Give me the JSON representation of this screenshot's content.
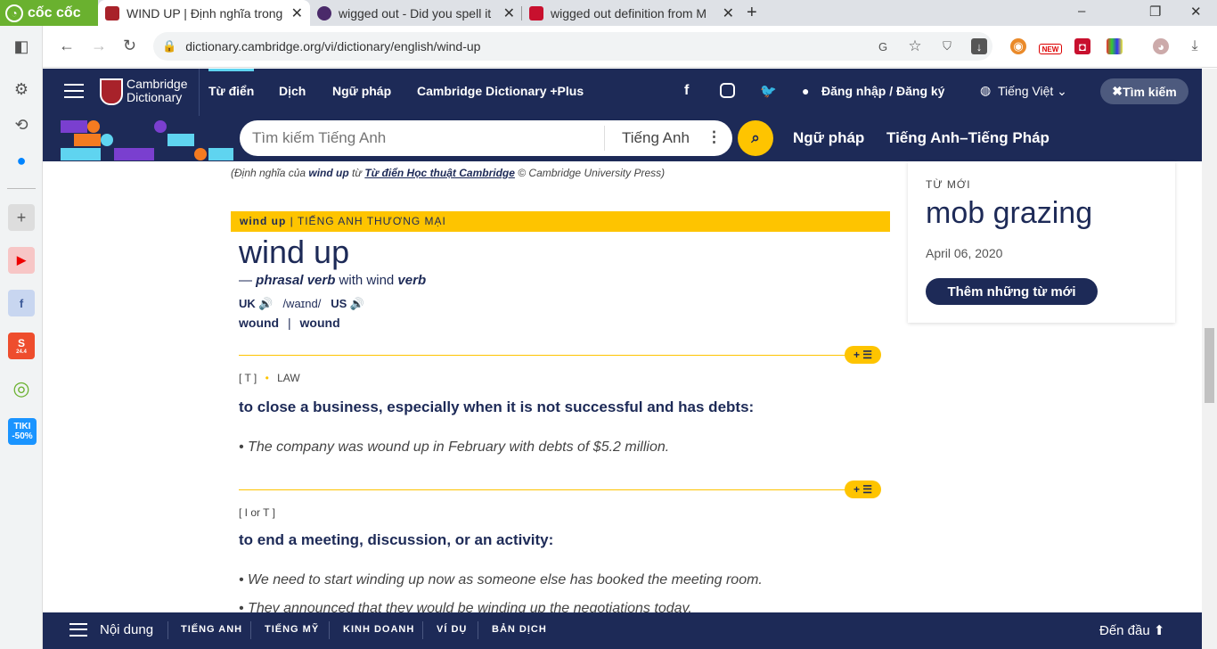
{
  "browser": {
    "logo": "cốc cốc",
    "tabs": [
      {
        "title": "WIND UP | Định nghĩa trong",
        "active": true
      },
      {
        "title": "wigged out - Did you spell it",
        "active": false
      },
      {
        "title": "wigged out definition from M",
        "active": false
      }
    ],
    "url": "dictionary.cambridge.org/vi/dictionary/english/wind-up",
    "ext_badge_new": "NEW",
    "sidebar_tiki": "TIKI -50%",
    "sidebar_shopee_num": "24.4"
  },
  "header": {
    "brand_line1": "Cambridge",
    "brand_line2": "Dictionary",
    "nav": [
      "Từ điển",
      "Dịch",
      "Ngữ pháp",
      "Cambridge Dictionary +Plus"
    ],
    "login": "Đăng nhập / Đăng ký",
    "language": "Tiếng Việt",
    "search_toggle": "Tìm kiếm"
  },
  "search": {
    "placeholder": "Tìm kiếm Tiếng Anh",
    "dictionary": "Tiếng Anh",
    "links": [
      "Ngữ pháp",
      "Tiếng Anh–Tiếng Pháp"
    ]
  },
  "entry": {
    "credit_pre": "(Định nghĩa của ",
    "credit_word": "wind up",
    "credit_mid": " từ ",
    "credit_source": "Từ điển Học thuật Cambridge",
    "credit_post": " © Cambridge University Press)",
    "section_word": "wind up",
    "section_label": " | TIẾNG ANH THƯƠNG MẠI",
    "headword": "wind up",
    "pos_dash": "— ",
    "pos": "phrasal verb",
    "pos_with": " with wind ",
    "pos_verb": "verb",
    "uk": "UK",
    "ipa": "/waɪnd/",
    "us": "US",
    "inflection1": "wound",
    "inflection_sep": "|",
    "inflection2": "wound",
    "pill": "+ ☰",
    "senses": [
      {
        "grammar": "[ T ]",
        "domain": "LAW",
        "definition": "to close a business, especially when it is not successful and has debts:",
        "examples": [
          "The company was wound up in February with debts of $5.2 million."
        ]
      },
      {
        "grammar": "[ I or T ]",
        "domain": "",
        "definition": "to end a meeting, discussion, or an activity:",
        "examples": [
          "We need to start winding up now as someone else has booked the meeting room.",
          "They announced that they would be winding up the negotiations today."
        ]
      }
    ]
  },
  "new_words": {
    "label": "TỪ MỚI",
    "word": "mob grazing",
    "date": "April 06, 2020",
    "button": "Thêm những từ mới"
  },
  "bottom_bar": {
    "contents": "Nội dung",
    "tabs": [
      "TIẾNG ANH",
      "TIẾNG MỸ",
      "KINH DOANH",
      "VÍ DỤ",
      "BẢN DỊCH"
    ],
    "top": "Đến đầu"
  },
  "colors": {
    "navy": "#1d2a57",
    "yellow": "#fec400",
    "coccoc_green": "#6ab12f"
  }
}
